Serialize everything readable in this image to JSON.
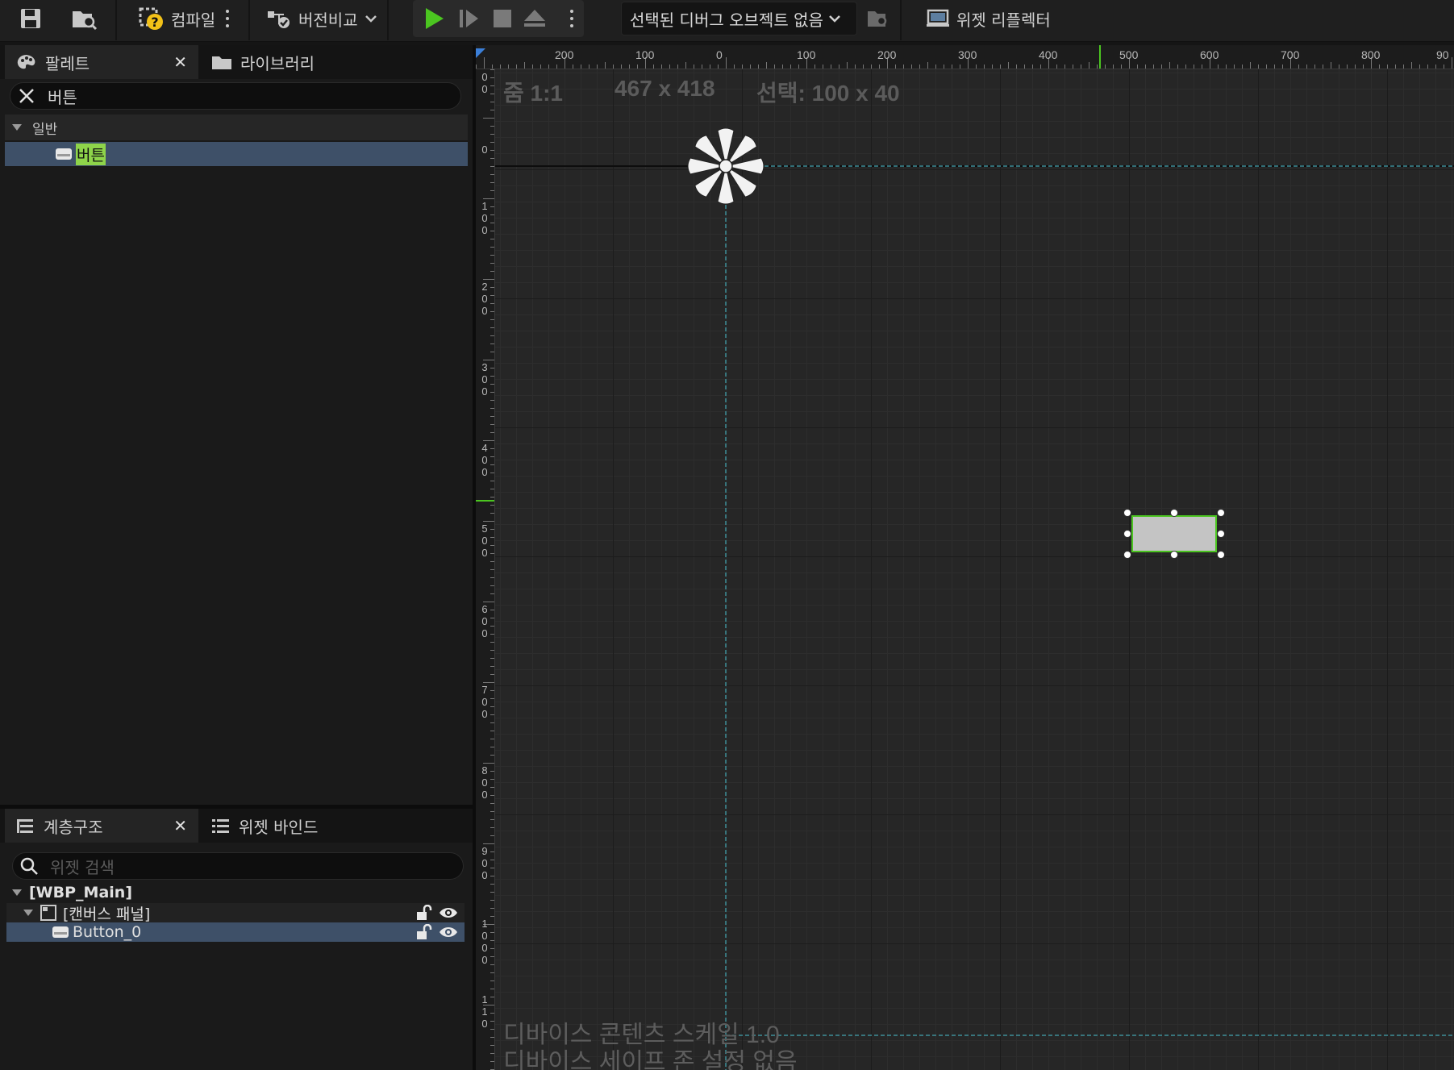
{
  "toolbar": {
    "compile_label": "컴파일",
    "diff_label": "버전비교",
    "debug_object": "선택된 디버그 오브젝트 없음",
    "widget_reflector": "위젯 리플렉터"
  },
  "palette": {
    "tab_label": "팔레트",
    "library_tab": "라이브러리",
    "search_value": "버튼",
    "category": "일반",
    "item_label": "버튼"
  },
  "hierarchy": {
    "tab_label": "계층구조",
    "bind_tab": "위젯 바인드",
    "search_placeholder": "위젯 검색",
    "root": "[WBP_Main]",
    "canvas": "[캔버스 패널]",
    "button": "Button_0"
  },
  "designer": {
    "zoom": "줌 1:1",
    "resolution": "467 x 418",
    "selection": "선택: 100 x 40",
    "dpi_scale": "디바이스 콘텐츠 스케일 1.0",
    "safe_zone": "디바이스 세이프 존 설정 없음",
    "ruler_top": [
      "200",
      "100",
      "0",
      "100",
      "200",
      "300",
      "400",
      "500",
      "600",
      "700",
      "800",
      "90"
    ],
    "ruler_left": [
      "0\n0",
      "0",
      "1\n0\n0",
      "2\n0\n0",
      "3\n0\n0",
      "4\n0\n0",
      "5\n0\n0",
      "6\n0\n0",
      "7\n0\n0",
      "8\n0\n0",
      "9\n0\n0",
      "1\n0\n0\n0",
      "1\n1\n0"
    ]
  },
  "colors": {
    "accent_green": "#4bc520",
    "selection_blue": "#3e5068",
    "search_highlight": "#8ed44a"
  }
}
